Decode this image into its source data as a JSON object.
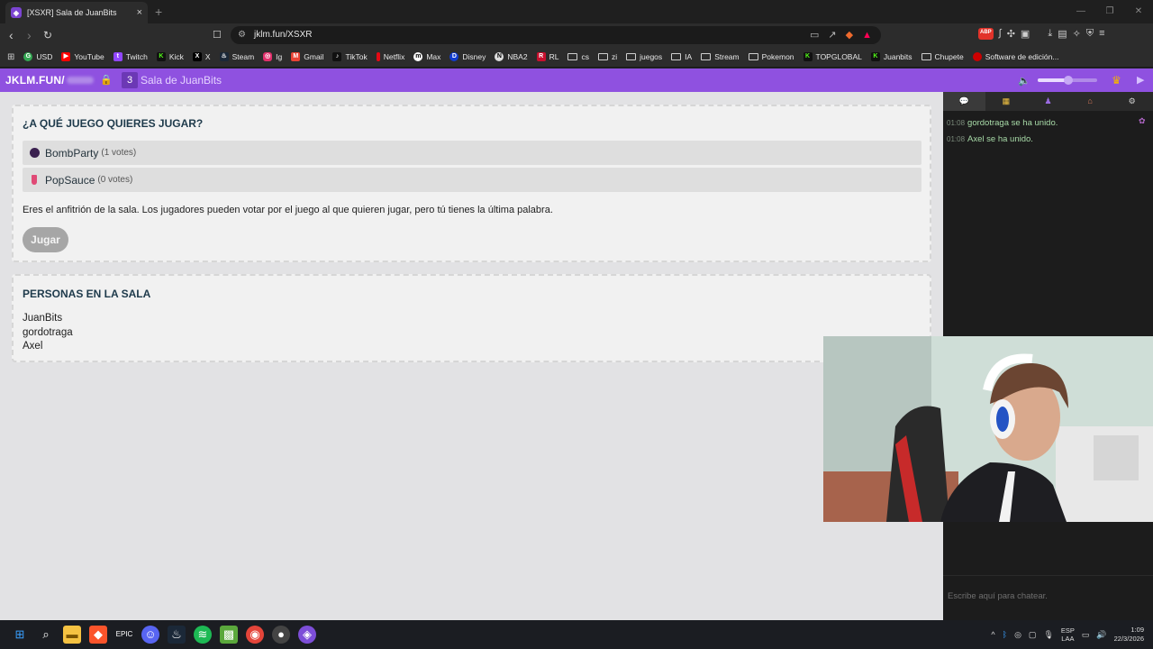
{
  "browser": {
    "tab_title": "[XSXR] Sala de JuanBits",
    "url": "jklm.fun/XSXR",
    "bookmarks": [
      "USD",
      "YouTube",
      "Twitch",
      "Kick",
      "X",
      "Steam",
      "Ig",
      "Gmail",
      "TikTok",
      "Netflix",
      "Max",
      "Disney",
      "NBA2",
      "RL",
      "cs",
      "zi",
      "juegos",
      "IA",
      "Stream",
      "Pokemon",
      "TOPGLOBAL",
      "Juanbits",
      "Chupete",
      "Software de edición..."
    ]
  },
  "room": {
    "brand": "JKLM.FUN/",
    "player_count": "3",
    "name": "Sala de JuanBits"
  },
  "vote": {
    "heading": "¿A QUÉ JUEGO QUIERES JUGAR?",
    "options": [
      {
        "name": "BombParty",
        "votes": "(1 votes)"
      },
      {
        "name": "PopSauce",
        "votes": "(0 votes)"
      }
    ],
    "host_note": "Eres el anfitrión de la sala. Los jugadores pueden votar por el juego al que quieren jugar, pero tú tienes la última palabra.",
    "play_button": "Jugar"
  },
  "people": {
    "heading": "PERSONAS EN LA SALA",
    "list": [
      "JuanBits",
      "gordotraga",
      "Axel"
    ]
  },
  "chat": {
    "messages": [
      {
        "time": "01:08",
        "text": "gordotraga se ha unido."
      },
      {
        "time": "01:08",
        "text": "Axel se ha unido."
      }
    ],
    "placeholder": "Escribe aquí para chatear."
  },
  "taskbar": {
    "lang_top": "ESP",
    "lang_bottom": "LAA",
    "time": "1:09",
    "date": "22/3/2026"
  },
  "colors": {
    "room_bar": "#8f51e0",
    "heading": "#1e3a4b",
    "chat_join": "#a8dba8"
  }
}
